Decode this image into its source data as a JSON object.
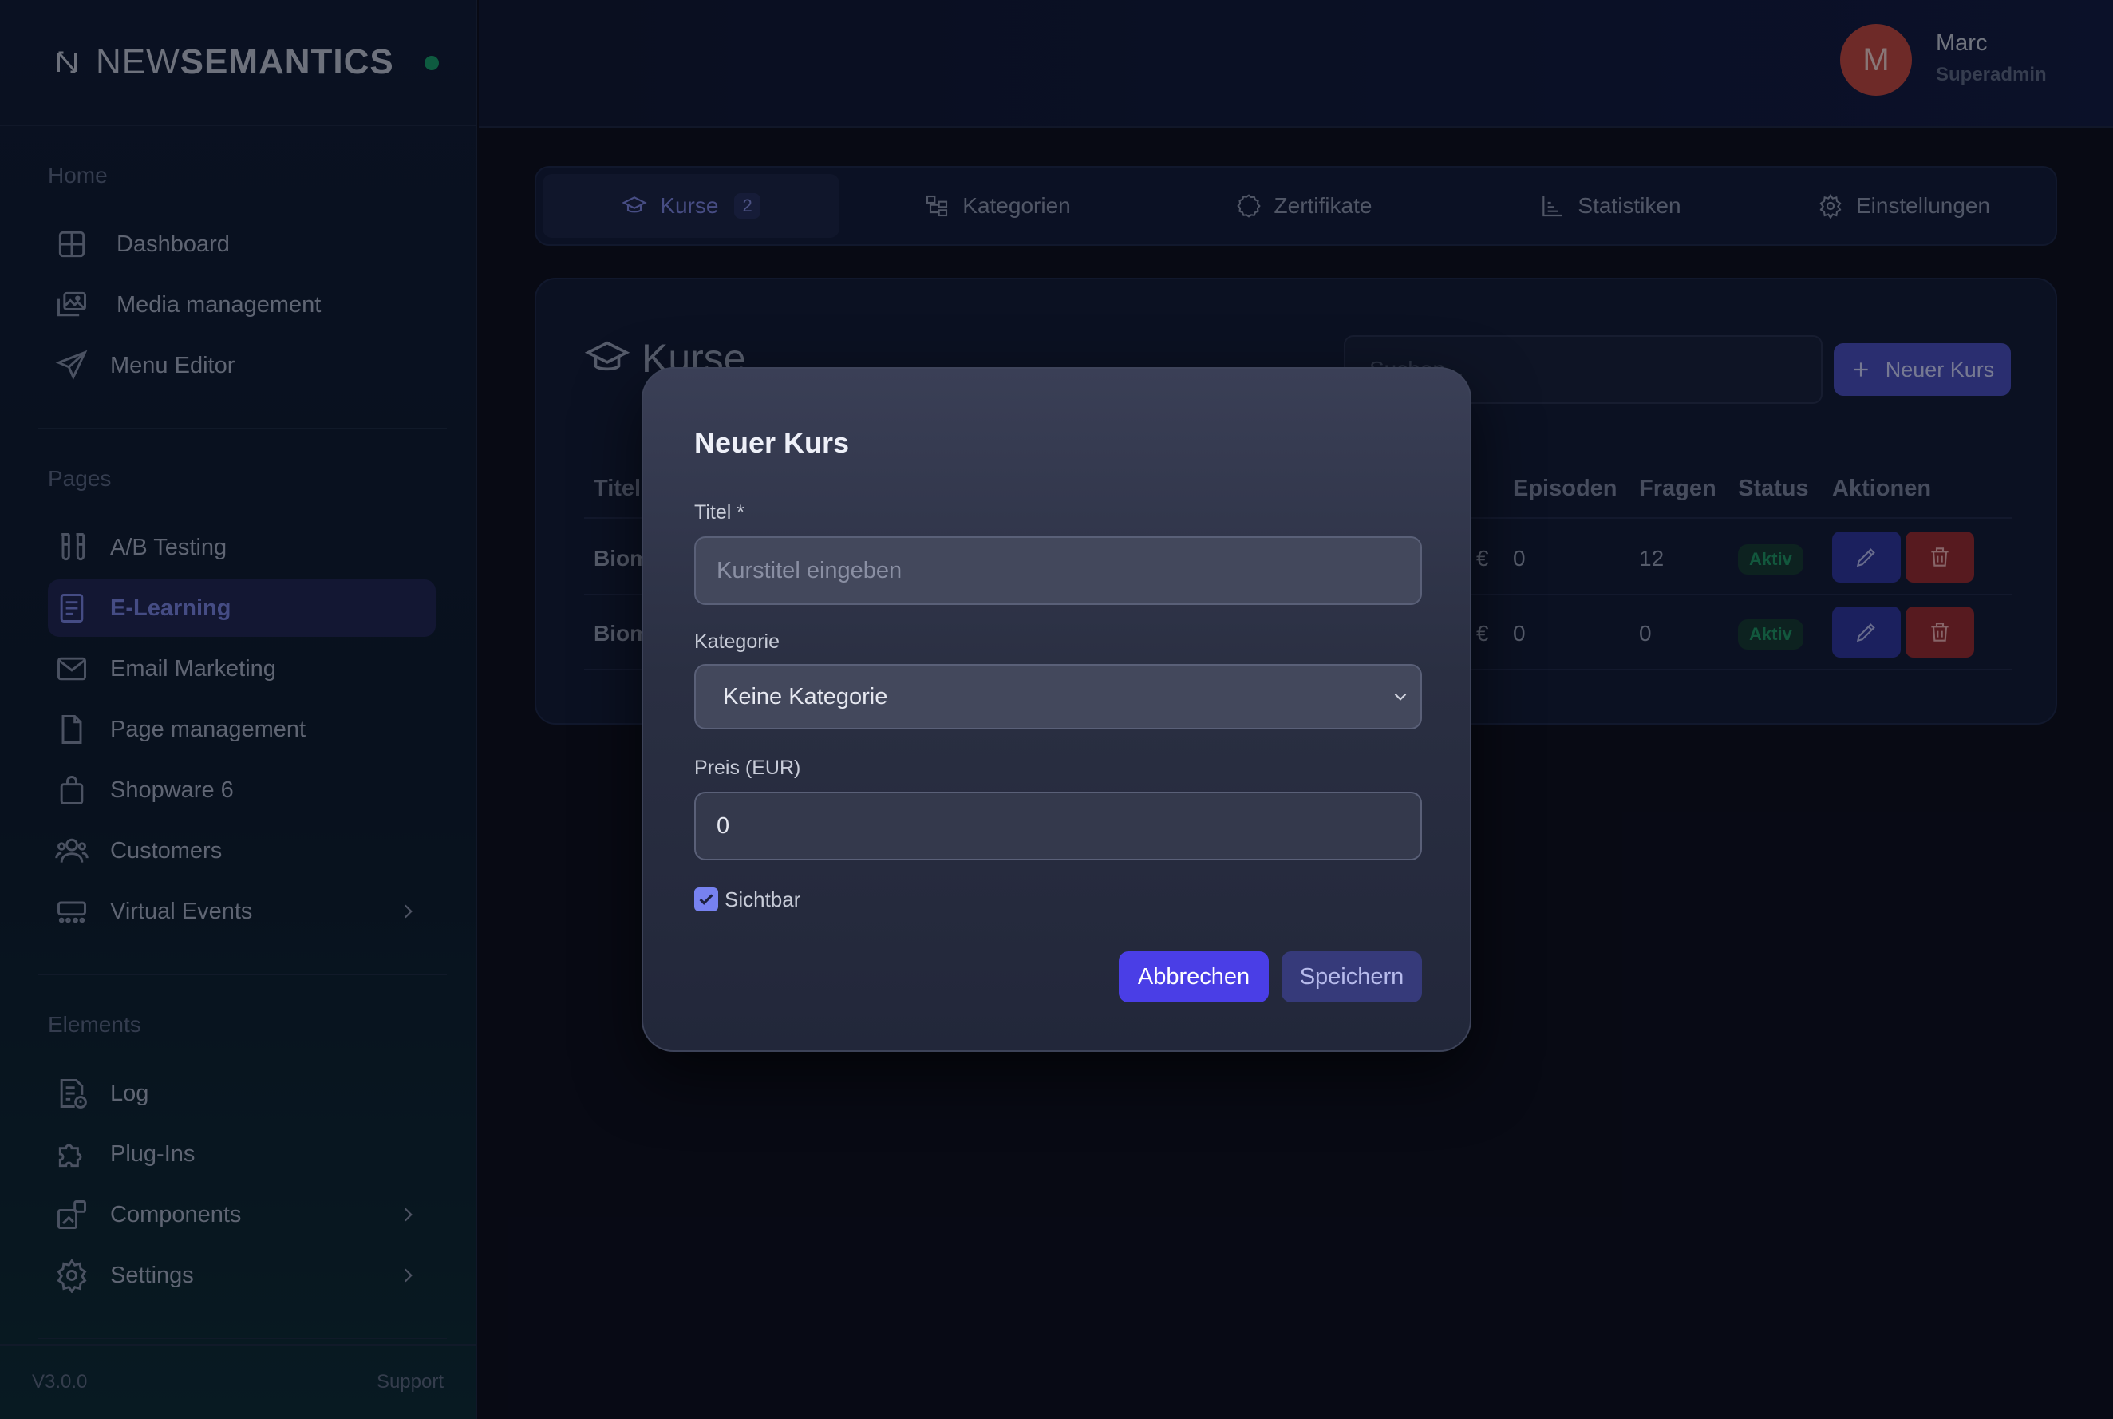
{
  "brand": {
    "prefix": "NEW",
    "name": "SEMANTICS"
  },
  "user": {
    "initial": "M",
    "name": "Marc",
    "role": "Superadmin"
  },
  "sidebar": {
    "sections": [
      {
        "heading": "Home",
        "items": [
          {
            "label": "Dashboard",
            "icon": "grid-icon"
          },
          {
            "label": "Media management",
            "icon": "images-icon"
          },
          {
            "label": "Menu Editor",
            "icon": "send-icon"
          }
        ]
      },
      {
        "heading": "Pages",
        "items": [
          {
            "label": "A/B Testing",
            "icon": "test-tubes-icon"
          },
          {
            "label": "E-Learning",
            "icon": "book-icon",
            "active": true
          },
          {
            "label": "Email Marketing",
            "icon": "mail-icon"
          },
          {
            "label": "Page management",
            "icon": "file-icon"
          },
          {
            "label": "Shopware 6",
            "icon": "shopping-bag-icon"
          },
          {
            "label": "Customers",
            "icon": "users-icon"
          },
          {
            "label": "Virtual Events",
            "icon": "event-icon",
            "expandable": true
          }
        ]
      },
      {
        "heading": "Elements",
        "items": [
          {
            "label": "Log",
            "icon": "log-file-icon"
          },
          {
            "label": "Plug-Ins",
            "icon": "puzzle-icon"
          },
          {
            "label": "Components",
            "icon": "components-icon",
            "expandable": true
          },
          {
            "label": "Settings",
            "icon": "gear-icon",
            "expandable": true
          }
        ]
      }
    ],
    "version": "V3.0.0",
    "support": "Support"
  },
  "tabs": [
    {
      "label": "Kurse",
      "count": "2",
      "active": true,
      "icon": "graduation-cap-icon"
    },
    {
      "label": "Kategorien",
      "icon": "folder-tree-icon"
    },
    {
      "label": "Zertifikate",
      "icon": "badge-icon"
    },
    {
      "label": "Statistiken",
      "icon": "bar-chart-icon"
    },
    {
      "label": "Einstellungen",
      "icon": "gear-icon"
    }
  ],
  "panel": {
    "title": "Kurse",
    "search_placeholder": "Suchen...",
    "new_button": "Neuer Kurs",
    "columns": [
      "Titel",
      "Episoden",
      "Fragen",
      "Status",
      "Aktionen"
    ],
    "rows": [
      {
        "title": "Biom",
        "price_suffix": "€",
        "episodes": "0",
        "questions": "12",
        "status": "Aktiv"
      },
      {
        "title": "Biom",
        "price_suffix": "€",
        "episodes": "0",
        "questions": "0",
        "status": "Aktiv"
      }
    ]
  },
  "modal": {
    "title": "Neuer Kurs",
    "title_label": "Titel *",
    "title_placeholder": "Kurstitel eingeben",
    "category_label": "Kategorie",
    "category_value": "Keine Kategorie",
    "price_label": "Preis (EUR)",
    "price_value": "0",
    "visible_label": "Sichtbar",
    "visible_checked": true,
    "cancel": "Abbrechen",
    "save": "Speichern"
  },
  "colors": {
    "accent": "#4a3ee6",
    "active_nav": "#7a86e6",
    "avatar": "#c5483f",
    "status_green": "#1e9a64",
    "delete_red": "#9b2a2f"
  }
}
